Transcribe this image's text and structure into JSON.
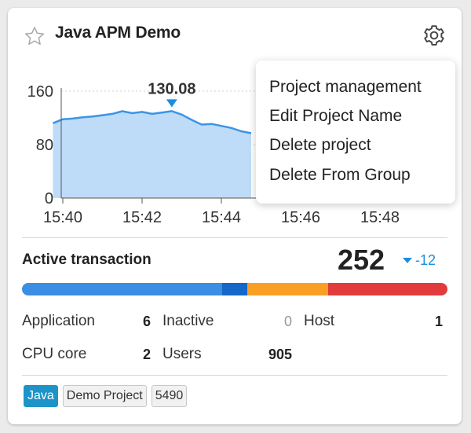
{
  "card": {
    "title": "Java APM Demo",
    "star_icon": "star-outline-icon",
    "settings_icon": "gear-icon"
  },
  "chart_data": {
    "type": "area",
    "title": "",
    "xlabel": "",
    "ylabel": "",
    "x": [
      "15:39:45",
      "15:40:00",
      "15:40:15",
      "15:40:30",
      "15:40:45",
      "15:41:00",
      "15:41:15",
      "15:41:30",
      "15:41:45",
      "15:42:00",
      "15:42:15",
      "15:42:30",
      "15:42:45",
      "15:43:00",
      "15:43:15",
      "15:43:30",
      "15:43:45",
      "15:44:00",
      "15:44:15",
      "15:44:30",
      "15:44:45"
    ],
    "y": [
      112,
      118,
      119,
      121,
      122,
      124,
      126,
      130,
      127,
      129,
      126,
      128,
      130.08,
      125,
      117,
      110,
      111,
      108,
      105,
      100,
      97
    ],
    "x_ticks": [
      "15:40",
      "15:42",
      "15:44",
      "15:46",
      "15:48"
    ],
    "y_ticks": [
      "160",
      "80",
      "0"
    ],
    "ylim": [
      0,
      160
    ],
    "grid": true,
    "peak_label": "130.08",
    "colors": {
      "line": "#3a95e6",
      "fill": "#bedcf8",
      "marker": "#1a8ee0"
    }
  },
  "menu": {
    "items": [
      "Project management",
      "Edit Project Name",
      "Delete project",
      "Delete From Group"
    ]
  },
  "active": {
    "label": "Active transaction",
    "value": "252",
    "delta": "-12",
    "delta_icon": "triangle-down-icon",
    "segments": [
      {
        "name": "normal",
        "fraction": 0.47,
        "color": "#3a8fe4"
      },
      {
        "name": "slow",
        "fraction": 0.06,
        "color": "#1667c8"
      },
      {
        "name": "very-slow",
        "fraction": 0.19,
        "color": "#f9a024"
      },
      {
        "name": "very-very-slow",
        "fraction": 0.28,
        "color": "#e23b3b"
      }
    ]
  },
  "stats": {
    "application_label": "Application",
    "application_value": "6",
    "inactive_label": "Inactive",
    "inactive_value": "0",
    "host_label": "Host",
    "host_value": "1",
    "cpu_label": "CPU core",
    "cpu_value": "2",
    "users_label": "Users",
    "users_value": "905"
  },
  "tags": [
    "Java",
    "Demo Project",
    "5490"
  ]
}
